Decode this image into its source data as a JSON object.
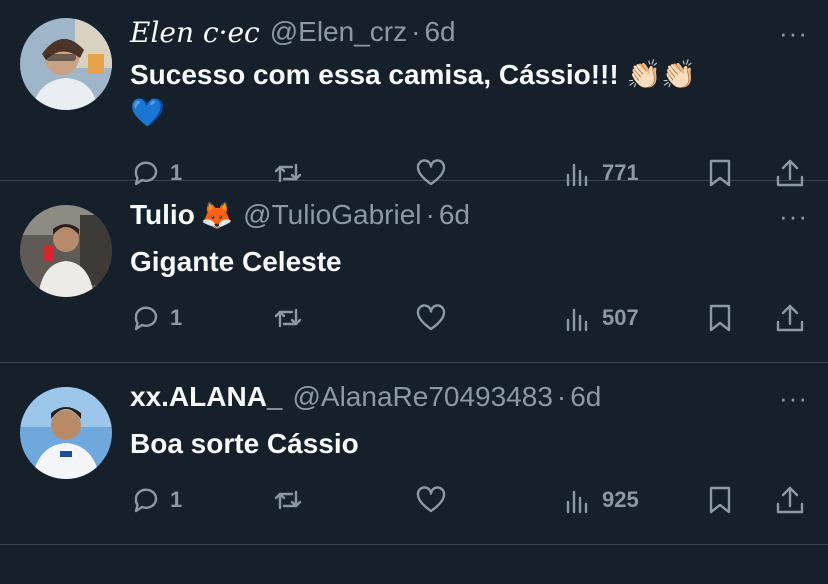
{
  "tweets": [
    {
      "name": "Elen c·ec",
      "handle": "@Elen_crz",
      "dot": "·",
      "time": "6d",
      "text": "Sucesso com essa camisa, Cássio!!! 👏🏻👏🏻",
      "text2": "💙",
      "replies": "1",
      "views": "771",
      "more": "···"
    },
    {
      "name": "Tulio",
      "name_emoji": "🦊",
      "handle": "@TulioGabriel",
      "dot": "·",
      "time": "6d",
      "text": "Gigante Celeste",
      "replies": "1",
      "views": "507",
      "more": "···"
    },
    {
      "name": "xx.ALANA_",
      "handle": "@AlanaRe70493483",
      "dot": "·",
      "time": "6d",
      "text": "Boa sorte Cássio",
      "replies": "1",
      "views": "925",
      "more": "···"
    }
  ],
  "colors": {
    "background": "#15202b",
    "text": "#f7f9f9",
    "muted": "#8b98a5",
    "divider": "#38444d"
  }
}
